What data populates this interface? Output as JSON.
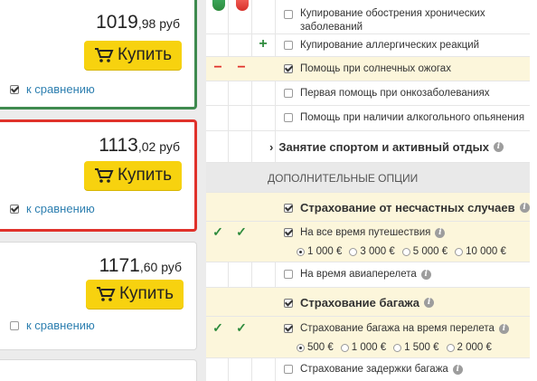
{
  "offers": [
    {
      "price_int": "1019",
      "price_frac": ",98 руб",
      "buy_label": "Купить",
      "compare_label": "к сравнению",
      "compare_checked": true
    },
    {
      "price_int": "1113",
      "price_frac": ",02 руб",
      "buy_label": "Купить",
      "compare_label": "к сравнению",
      "compare_checked": true
    },
    {
      "price_int": "1171",
      "price_frac": ",60 руб",
      "buy_label": "Купить",
      "compare_label": "к сравнению",
      "compare_checked": false
    }
  ],
  "options": {
    "r1": "Купирование обострения хронических заболеваний",
    "r2": "Купирование аллергических реакций",
    "r3": "Помощь при солнечных ожогах",
    "r4": "Первая помощь при онкозаболеваниях",
    "r5": "Помощь при наличии алкогольного опьянения",
    "sport": "Занятие спортом и активный отдых",
    "section": "ДОПОЛНИТЕЛЬНЫЕ ОПЦИИ",
    "accident": "Страхование от несчастных случаев",
    "whole_trip": "На все время путешествия",
    "flight": "На время авиаперелета",
    "baggage": "Страхование багажа",
    "baggage_flight": "Страхование багажа на время перелета",
    "baggage_delay": "Страхование задержки багажа"
  },
  "accident_amounts": [
    "1 000 €",
    "3 000 €",
    "5 000 €",
    "10 000 €"
  ],
  "baggage_amounts": [
    "500 €",
    "1 000 €",
    "1 500 €",
    "2 000 €"
  ],
  "colors": {
    "green": "#2e8b3d",
    "red": "#e0322b",
    "yellow": "#f7d20f",
    "highlight": "#fcf6db"
  }
}
